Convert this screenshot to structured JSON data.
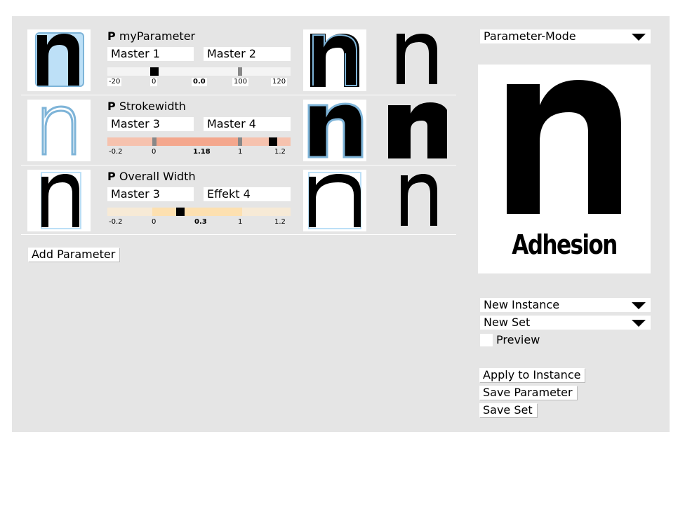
{
  "parameters": [
    {
      "title_prefix": "P",
      "title": "myParameter",
      "master_a": "Master 1",
      "master_b": "Master 2",
      "ticks": [
        "-20",
        "0",
        "0.0",
        "100",
        "120"
      ],
      "value_fraction": 0.24
    },
    {
      "title_prefix": "P",
      "title": "Strokewidth",
      "master_a": "Master 3",
      "master_b": "Master 4",
      "ticks": [
        "-0.2",
        "0",
        "1.18",
        "1",
        "1.2"
      ],
      "value_fraction": 0.89,
      "track_color": "#f4a78d"
    },
    {
      "title_prefix": "P",
      "title": "Overall Width",
      "master_a": "Master 3",
      "master_b": "Effekt 4",
      "ticks": [
        "-0.2",
        "0",
        "0.3",
        "1",
        "1.2"
      ],
      "value_fraction": 0.4,
      "track_color": "#fde0b0"
    }
  ],
  "add_parameter_label": "Add Parameter",
  "mode_dropdown": "Parameter-Mode",
  "preview_glyph": "n",
  "preview_name": "Adhesion",
  "instance_dropdown": "New Instance",
  "set_dropdown": "New Set",
  "preview_checkbox_label": "Preview",
  "apply_button": "Apply to Instance",
  "save_parameter_button": "Save Parameter",
  "save_set_button": "Save Set",
  "colors": {
    "panel": "#e5e5e5",
    "outline_blue": "#7eb4d8",
    "fill_blue": "#bde0f7",
    "stroke_track": "#f4a78d",
    "width_track": "#fde0b0"
  },
  "icons": [
    "glyph-thumbnail",
    "dropdown-arrow-icon"
  ]
}
